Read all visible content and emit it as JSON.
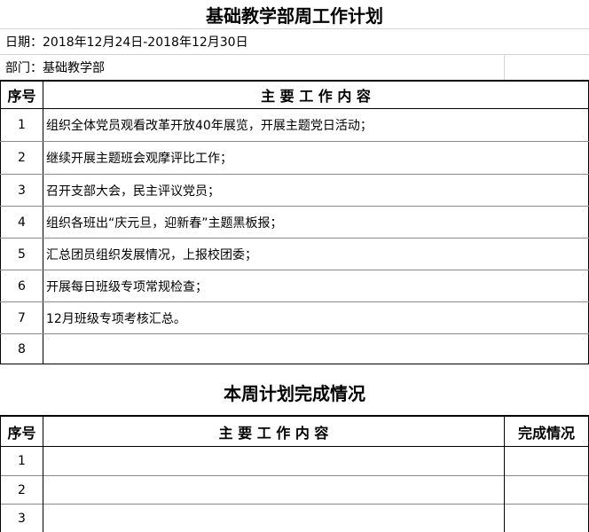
{
  "title": "基础教学部周工作计划",
  "date_line": "日期：2018年12月24日-2018年12月30日",
  "department_line": "部门：基础教学部",
  "plan_table": {
    "header": {
      "index": "序号",
      "content": "主 要 工 作 内 容"
    },
    "rows": [
      {
        "index": "1",
        "content": "组织全体党员观看改革开放40年展览，开展主题党日活动；"
      },
      {
        "index": "2",
        "content": "继续开展主题班会观摩评比工作；"
      },
      {
        "index": "3",
        "content": "召开支部大会，民主评议党员；"
      },
      {
        "index": "4",
        "content": "组织各班出“庆元旦，迎新春”主题黑板报；"
      },
      {
        "index": "5",
        "content": "汇总团员组织发展情况，上报校团委；"
      },
      {
        "index": "6",
        "content": "开展每日班级专项常规检查；"
      },
      {
        "index": "7",
        "content": "12月班级专项考核汇总。"
      },
      {
        "index": "8",
        "content": ""
      }
    ]
  },
  "completion_section": {
    "title": "本周计划完成情况",
    "header": {
      "index": "序号",
      "content": "主 要 工 作 内 容",
      "status": "完成情况"
    },
    "rows": [
      {
        "index": "1",
        "content": "",
        "status": ""
      },
      {
        "index": "2",
        "content": "",
        "status": ""
      },
      {
        "index": "3",
        "content": "",
        "status": ""
      }
    ]
  }
}
